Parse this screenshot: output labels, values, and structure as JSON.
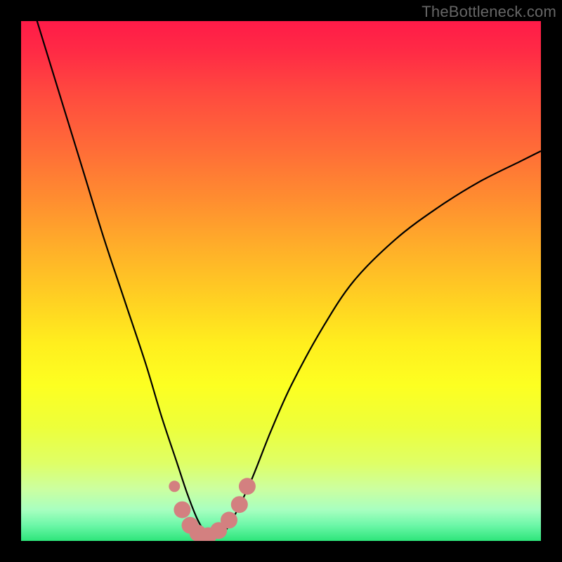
{
  "watermark": "TheBottleneck.com",
  "chart_data": {
    "type": "line",
    "title": "",
    "xlabel": "",
    "ylabel": "",
    "xlim": [
      0,
      100
    ],
    "ylim": [
      0,
      100
    ],
    "grid": false,
    "legend": false,
    "series": [
      {
        "name": "bottleneck-curve",
        "x": [
          0,
          4,
          8,
          12,
          16,
          20,
          24,
          27,
          30,
          32,
          34,
          36,
          38,
          40,
          44,
          48,
          52,
          58,
          64,
          72,
          80,
          88,
          96,
          100
        ],
        "values": [
          110,
          97,
          84,
          71,
          58,
          46,
          34,
          24,
          15,
          9,
          4,
          1,
          1,
          3,
          11,
          21,
          30,
          41,
          50,
          58,
          64,
          69,
          73,
          75
        ]
      }
    ],
    "markers": {
      "name": "highlight-dots",
      "color": "#d38080",
      "points": [
        {
          "x": 29.5,
          "y": 10.5
        },
        {
          "x": 31.0,
          "y": 6.0
        },
        {
          "x": 32.5,
          "y": 3.0
        },
        {
          "x": 34.0,
          "y": 1.5
        },
        {
          "x": 36.0,
          "y": 1.0
        },
        {
          "x": 38.0,
          "y": 2.0
        },
        {
          "x": 40.0,
          "y": 4.0
        },
        {
          "x": 42.0,
          "y": 7.0
        },
        {
          "x": 43.5,
          "y": 10.5
        }
      ]
    },
    "gradient_stops": [
      {
        "offset": 0.0,
        "color": "#ff1b48"
      },
      {
        "offset": 0.06,
        "color": "#ff2b45"
      },
      {
        "offset": 0.14,
        "color": "#ff4a3f"
      },
      {
        "offset": 0.24,
        "color": "#ff6a38"
      },
      {
        "offset": 0.34,
        "color": "#ff8c30"
      },
      {
        "offset": 0.44,
        "color": "#ffb029"
      },
      {
        "offset": 0.54,
        "color": "#ffd222"
      },
      {
        "offset": 0.62,
        "color": "#ffee1e"
      },
      {
        "offset": 0.7,
        "color": "#fdff21"
      },
      {
        "offset": 0.78,
        "color": "#edff3a"
      },
      {
        "offset": 0.85,
        "color": "#dfff66"
      },
      {
        "offset": 0.9,
        "color": "#ccffa0"
      },
      {
        "offset": 0.94,
        "color": "#a8ffc0"
      },
      {
        "offset": 0.97,
        "color": "#6cf7a8"
      },
      {
        "offset": 1.0,
        "color": "#2de57a"
      }
    ]
  }
}
